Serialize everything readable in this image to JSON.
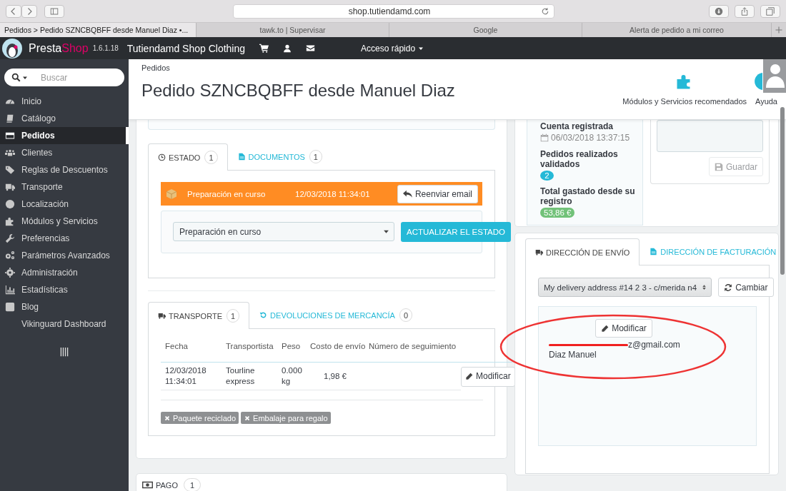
{
  "browser": {
    "url": "shop.tutiendamd.com",
    "tabs": [
      {
        "label": "Pedidos > Pedido SZNCBQBFF desde Manuel Diaz •...",
        "selected": true
      },
      {
        "label": "tawk.to | Supervisar",
        "selected": false
      },
      {
        "label": "Google",
        "selected": false
      },
      {
        "label": "Alerta de pedido a mi correo",
        "selected": false
      }
    ]
  },
  "topbar": {
    "brand_first": "Presta",
    "brand_second": "Shop",
    "version": "1.6.1.18",
    "shop_name": "Tutiendamd Shop Clothing",
    "quick_access": "Acceso rápido"
  },
  "sidebar": {
    "search_placeholder": "Buscar",
    "items": [
      {
        "label": "Inicio",
        "selected": false
      },
      {
        "label": "Catálogo",
        "selected": false
      },
      {
        "label": "Pedidos",
        "selected": true
      },
      {
        "label": "Clientes",
        "selected": false
      },
      {
        "label": "Reglas de Descuentos",
        "selected": false
      },
      {
        "label": "Transporte",
        "selected": false
      },
      {
        "label": "Localización",
        "selected": false
      },
      {
        "label": "Módulos y Servicios",
        "selected": false
      },
      {
        "label": "Preferencias",
        "selected": false
      },
      {
        "label": "Parámetros Avanzados",
        "selected": false
      },
      {
        "label": "Administración",
        "selected": false
      },
      {
        "label": "Estadísticas",
        "selected": false
      },
      {
        "label": "Blog",
        "selected": false
      },
      {
        "label": "Vikinguard Dashboard",
        "selected": false
      }
    ]
  },
  "page": {
    "breadcrumb": "Pedidos",
    "title": "Pedido SZNCBQBFF desde Manuel Diaz",
    "toolbar": [
      {
        "label": "Módulos y Servicios recomendados"
      },
      {
        "label": "Ayuda"
      }
    ]
  },
  "status_panel": {
    "tabs": [
      {
        "label": "ESTADO",
        "count": "1",
        "selected": true
      },
      {
        "label": "DOCUMENTOS",
        "count": "1",
        "selected": false
      }
    ],
    "history": [
      {
        "state": "Preparación en curso",
        "date": "12/03/2018 11:34:01",
        "color": "#ff8c23",
        "button": "Reenviar email"
      }
    ],
    "state_select": "Preparación en curso",
    "update_button": "ACTUALIZAR EL ESTADO"
  },
  "shipping_panel": {
    "tabs": [
      {
        "label": "TRANSPORTE",
        "count": "1",
        "selected": true
      },
      {
        "label": "DEVOLUCIONES DE MERCANCÍA",
        "count": "0",
        "selected": false
      }
    ],
    "columns": [
      "Fecha",
      "Transportista",
      "Peso",
      "Costo de envío",
      "Número de seguimiento"
    ],
    "rows": [
      {
        "cells": [
          "12/03/2018 11:34:01",
          "Tourline express",
          "0.000 kg",
          "1,98 €"
        ],
        "button": "Modificar"
      }
    ],
    "options": [
      {
        "label": "Paquete reciclado",
        "on": false
      },
      {
        "label": "Embalaje para regalo",
        "on": false
      }
    ]
  },
  "payment_panel": {
    "title": "PAGO",
    "count": "1"
  },
  "customer": {
    "account_label": "Cuenta registrada",
    "account_date": "06/03/2018 13:37:15",
    "orders_label": "Pedidos realizados validados",
    "orders_count": "2",
    "spent_label": "Total gastado desde su registro",
    "spent_total": "53,86 €"
  },
  "notes": {
    "save_button": "Guardar",
    "disabled": true
  },
  "address_panel": {
    "tabs": [
      {
        "label": "DIRECCIÓN DE ENVÍO",
        "selected": true
      },
      {
        "label": "DIRECCIÓN DE FACTURACIÓN",
        "selected": false
      }
    ],
    "address_select": "My delivery address #14 2 3 - c/merida n4",
    "change_button": "Cambiar",
    "edit_button": "Modificar",
    "email": "z@gmail.com",
    "name": "Diaz Manuel"
  }
}
